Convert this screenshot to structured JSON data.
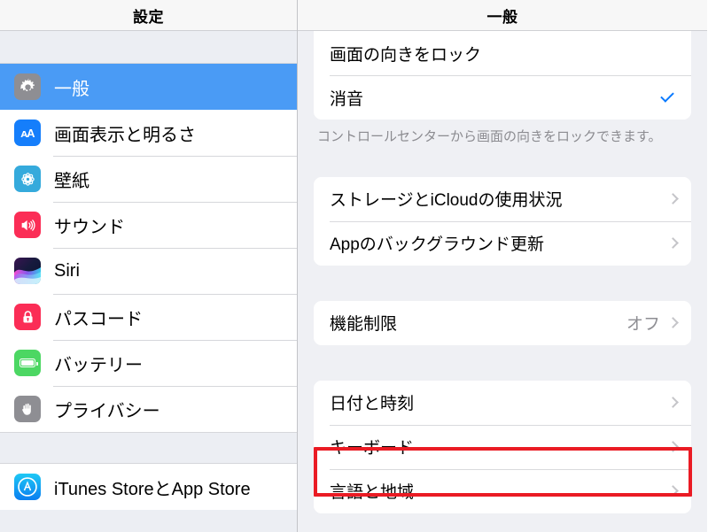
{
  "sidebar": {
    "header_title": "設定",
    "groups": [
      {
        "items": [
          {
            "label": "一般",
            "icon": "gear-icon",
            "selected": true
          },
          {
            "label": "画面表示と明るさ",
            "icon": "text-size-icon",
            "selected": false
          },
          {
            "label": "壁紙",
            "icon": "wallpaper-flower-icon",
            "selected": false
          },
          {
            "label": "サウンド",
            "icon": "speaker-icon",
            "selected": false
          },
          {
            "label": "Siri",
            "icon": "siri-waveform-icon",
            "selected": false
          },
          {
            "label": "パスコード",
            "icon": "lock-icon",
            "selected": false
          },
          {
            "label": "バッテリー",
            "icon": "battery-icon",
            "selected": false
          },
          {
            "label": "プライバシー",
            "icon": "hand-icon",
            "selected": false
          }
        ]
      },
      {
        "items": [
          {
            "label": "iTunes StoreとApp Store",
            "icon": "app-store-icon",
            "selected": false
          }
        ]
      }
    ]
  },
  "content": {
    "header_title": "一般",
    "section_lock": {
      "rows": [
        {
          "label": "画面の向きをロック",
          "accessory": "none",
          "value": ""
        },
        {
          "label": "消音",
          "accessory": "check",
          "value": ""
        }
      ],
      "footnote": "コントロールセンターから画面の向きをロックできます。"
    },
    "section_storage": {
      "rows": [
        {
          "label": "ストレージとiCloudの使用状況",
          "accessory": "chevron",
          "value": ""
        },
        {
          "label": "Appのバックグラウンド更新",
          "accessory": "chevron",
          "value": ""
        }
      ]
    },
    "section_restrictions": {
      "rows": [
        {
          "label": "機能制限",
          "accessory": "chevron",
          "value": "オフ"
        }
      ]
    },
    "section_datetime": {
      "rows": [
        {
          "label": "日付と時刻",
          "accessory": "chevron",
          "value": ""
        },
        {
          "label": "キーボード",
          "accessory": "chevron",
          "value": "",
          "highlighted": true
        },
        {
          "label": "言語と地域",
          "accessory": "chevron",
          "value": ""
        }
      ]
    }
  },
  "annotation": {
    "highlight_color": "#ea1b24",
    "highlight_target": "キーボード"
  },
  "colors": {
    "accent_blue": "#4a9bf5",
    "check_blue": "#0a7aff",
    "panel_bg": "#eff0f4",
    "card_bg": "#ffffff",
    "secondary_text": "#8e8e93"
  }
}
